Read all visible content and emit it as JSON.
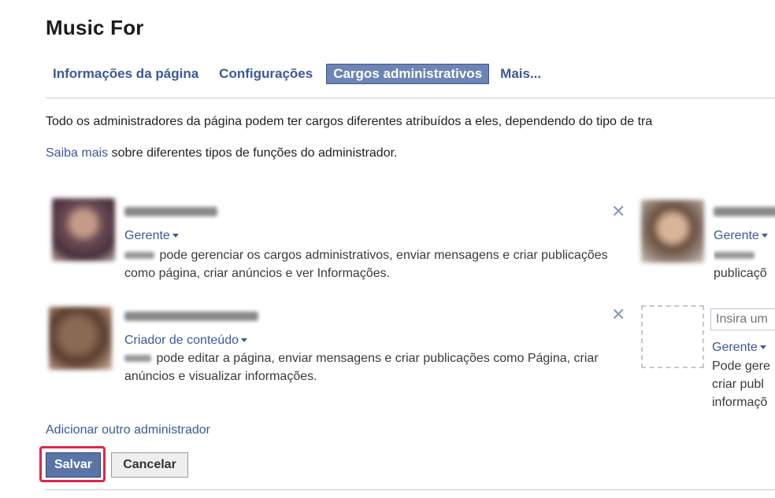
{
  "page": {
    "title": "Music For"
  },
  "tabs": [
    {
      "label": "Informações da página"
    },
    {
      "label": "Configurações"
    },
    {
      "label": "Cargos administrativos",
      "active": true
    },
    {
      "label": "Mais..."
    }
  ],
  "intro": "Todo os administradores da página podem ter cargos diferentes atribuídos a eles, dependendo do tipo de tra",
  "learn_more": {
    "link": "Saiba mais",
    "text": " sobre diferentes tipos de funções do administrador."
  },
  "admins": [
    {
      "role": "Gerente",
      "description": " pode gerenciar os cargos administrativos, enviar mensagens e criar publicações como página, criar anúncios e ver Informações."
    },
    {
      "role": "Gerente",
      "description": "publicaçõ"
    },
    {
      "role": "Criador de conteúdo",
      "description": " pode editar a página, enviar mensagens e criar publicações como Página, criar anúncios e visualizar informações."
    }
  ],
  "new_admin": {
    "placeholder": "Insira um",
    "role": "Gerente",
    "description_lines": [
      "Pode gere",
      "criar publ",
      "informaçõ"
    ]
  },
  "remove_symbol": "✕",
  "add_admin_link": "Adicionar outro administrador",
  "buttons": {
    "save": "Salvar",
    "cancel": "Cancelar"
  },
  "colors": {
    "link": "#3b5998",
    "active_tab": "#6d84b4",
    "highlight": "#e0264b"
  }
}
